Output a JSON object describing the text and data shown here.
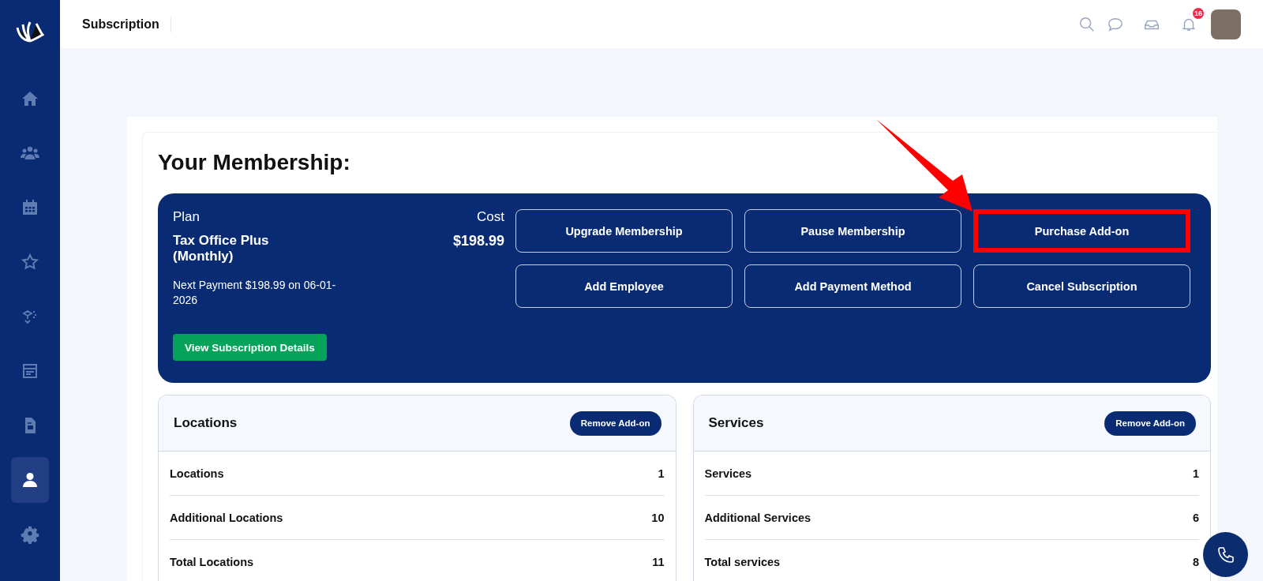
{
  "sidebar": {
    "items": [
      {
        "selected": false
      },
      {
        "selected": false
      },
      {
        "selected": false
      },
      {
        "selected": false
      },
      {
        "selected": false
      },
      {
        "selected": false
      },
      {
        "selected": false
      },
      {
        "selected": true
      },
      {
        "selected": false
      }
    ]
  },
  "top_bar": {
    "title": "Subscription",
    "notification_count": "16"
  },
  "membership": {
    "heading": "Your Membership:",
    "plan_label": "Plan",
    "plan_name": "Tax Office Plus (Monthly)",
    "next_payment": "Next Payment $198.99 on 06-01-2026",
    "cost_label": "Cost",
    "cost": "$198.99",
    "details_button": "View Subscription Details",
    "actions": [
      {
        "label": "Upgrade Membership",
        "highlighted": false
      },
      {
        "label": "Pause Membership",
        "highlighted": false
      },
      {
        "label": "Purchase Add-on",
        "highlighted": true
      },
      {
        "label": "Add Employee",
        "highlighted": false
      },
      {
        "label": "Add Payment Method",
        "highlighted": false
      },
      {
        "label": "Cancel Subscription",
        "highlighted": false
      }
    ]
  },
  "panels": [
    {
      "title": "Locations",
      "button": "Remove Add-on",
      "rows": [
        {
          "label": "Locations",
          "value": "1"
        },
        {
          "label": "Additional Locations",
          "value": "10"
        },
        {
          "label": "Total Locations",
          "value": "11"
        }
      ]
    },
    {
      "title": "Services",
      "button": "Remove Add-on",
      "rows": [
        {
          "label": "Services",
          "value": "1"
        },
        {
          "label": "Additional Services",
          "value": "6"
        },
        {
          "label": "Total services",
          "value": "8"
        }
      ]
    }
  ]
}
